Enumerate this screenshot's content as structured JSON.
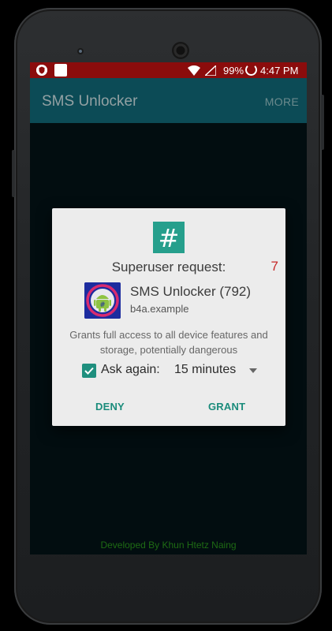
{
  "status_bar": {
    "shield_icon": "shield-icon",
    "battery_percent": "99%",
    "time": "4:47 PM"
  },
  "app_bar": {
    "title": "SMS Unlocker",
    "more_label": "MORE",
    "color": "#0c4b56"
  },
  "dialog": {
    "icon_glyph": "#",
    "title": "Superuser request:",
    "countdown": "7",
    "app_name": "SMS Unlocker (792)",
    "app_package": "b4a.example",
    "description": "Grants full access to all device features and storage, potentially dangerous",
    "ask_again_label": "Ask again:",
    "ask_again_checked": true,
    "duration_value": "15 minutes",
    "deny_label": "DENY",
    "grant_label": "GRANT",
    "accent_color": "#1a8c7b"
  },
  "footer": {
    "credit": "Developed By Khun Htetz Naing"
  }
}
